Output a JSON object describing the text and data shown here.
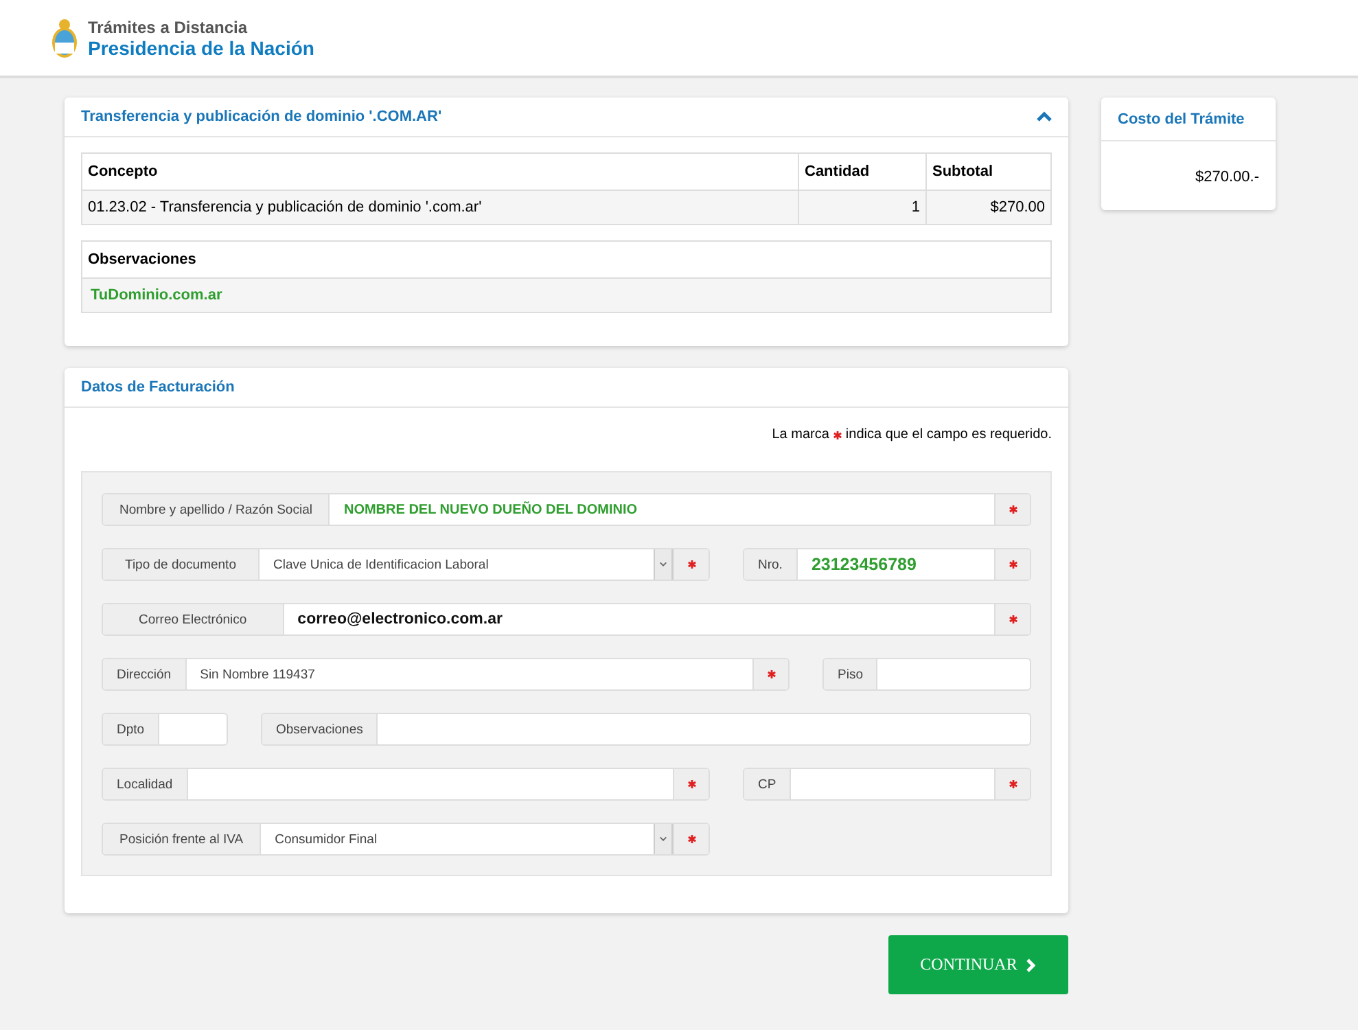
{
  "header": {
    "subtitle": "Trámites a Distancia",
    "title": "Presidencia de la Nación"
  },
  "order_panel": {
    "title": "Transferencia y publicación de dominio '.COM.AR'",
    "expanded": true,
    "table": {
      "columns": [
        "Concepto",
        "Cantidad",
        "Subtotal"
      ],
      "rows": [
        [
          "01.23.02 - Transferencia y publicación de dominio '.com.ar'",
          "1",
          "$270.00"
        ]
      ]
    },
    "notes": {
      "label": "Observaciones",
      "value": "TuDominio.com.ar"
    }
  },
  "billing_panel": {
    "title": "Datos de Facturación",
    "note_before": "La marca",
    "note_after": "indica que el campo es requerido.",
    "form_lines": [
      {
        "fields": [
          {
            "label": "Nombre y apellido / Razón Social",
            "value": "NOMBRE DEL NUEVO DUEÑO DEL DOMINIO",
            "kind": "text",
            "required": true,
            "highlighted": true,
            "bold": true
          }
        ]
      },
      {
        "fields": [
          {
            "label": "Tipo de documento",
            "value": "Clave Unica de Identificacion Laboral",
            "kind": "select",
            "required": true,
            "highlighted": false,
            "bold": false
          },
          {
            "label": "Nro.",
            "value": "23123456789",
            "kind": "text",
            "required": true,
            "highlighted": true,
            "bold": true
          }
        ]
      },
      {
        "fields": [
          {
            "label": "Correo Electrónico",
            "value": "correo@electronico.com.ar",
            "kind": "text",
            "required": true,
            "highlighted": false,
            "bold": true
          }
        ]
      },
      {
        "fields": [
          {
            "label": "Dirección",
            "value": "Sin Nombre 119437",
            "kind": "text",
            "required": true,
            "highlighted": false,
            "bold": false
          },
          {
            "label": "Piso",
            "kind": "text",
            "required": false
          }
        ]
      },
      {
        "fields": [
          {
            "label": "Dpto",
            "kind": "text",
            "required": false
          },
          {
            "label": "Observaciones",
            "kind": "text",
            "required": false
          }
        ]
      },
      {
        "fields": [
          {
            "label": "Localidad",
            "kind": "text",
            "required": true
          },
          {
            "label": "CP",
            "kind": "text",
            "required": true
          }
        ]
      },
      {
        "fields": [
          {
            "label": "Posición frente al IVA",
            "value": "Consumidor Final",
            "kind": "select",
            "required": true,
            "highlighted": false,
            "bold": false
          }
        ]
      }
    ]
  },
  "cost_panel": {
    "title": "Costo del Trámite",
    "amount": "$270.00.-"
  },
  "continue_button": {
    "label": "CONTINUAR"
  }
}
